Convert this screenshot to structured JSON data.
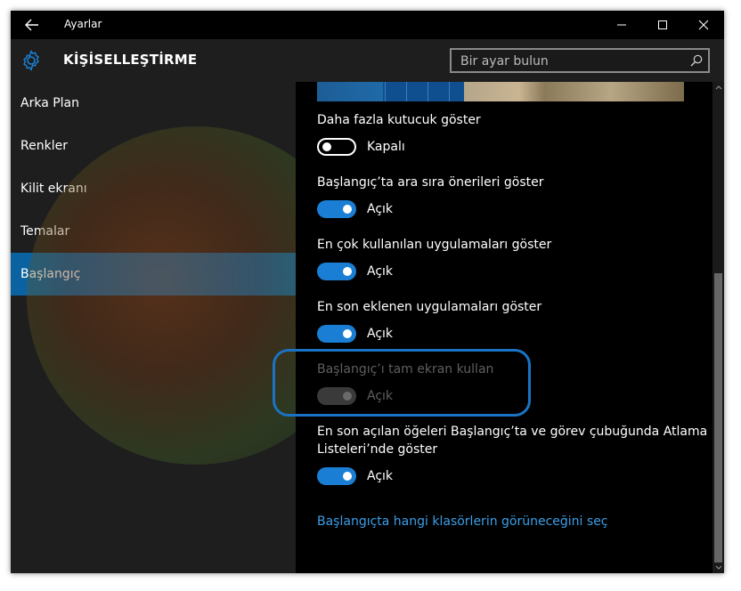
{
  "window": {
    "title": "Ayarlar",
    "icons": {
      "back": "back-arrow-icon",
      "minimize": "minimize-icon",
      "maximize": "maximize-icon",
      "close": "close-icon"
    }
  },
  "header": {
    "title": "KİŞİSELLEŞTİRME",
    "icon": "gear-icon",
    "search_placeholder": "Bir ayar bulun",
    "search_icon": "search-icon"
  },
  "sidebar": {
    "items": [
      {
        "label": "Arka Plan",
        "active": false
      },
      {
        "label": "Renkler",
        "active": false
      },
      {
        "label": "Kilit ekranı",
        "active": false
      },
      {
        "label": "Temalar",
        "active": false
      },
      {
        "label": "Başlangıç",
        "active": true
      }
    ]
  },
  "settings": [
    {
      "label": "Daha fazla kutucuk göster",
      "state": "Kapalı",
      "on": false,
      "enabled": true
    },
    {
      "label": "Başlangıç’ta ara sıra önerileri göster",
      "state": "Açık",
      "on": true,
      "enabled": true
    },
    {
      "label": "En çok kullanılan uygulamaları göster",
      "state": "Açık",
      "on": true,
      "enabled": true
    },
    {
      "label": "En son eklenen uygulamaları göster",
      "state": "Açık",
      "on": true,
      "enabled": true
    },
    {
      "label": "Başlangıç’ı tam ekran kullan",
      "state": "Açık",
      "on": true,
      "enabled": false
    },
    {
      "label_line1": "En son açılan öğeleri Başlangıç’ta ve görev çubuğunda Atlama",
      "label_line2": "Listeleri’nde göster",
      "state": "Açık",
      "on": true,
      "enabled": true
    }
  ],
  "link": "Başlangıçta hangi klasörlerin görüneceğini seç",
  "colors": {
    "accent": "#1a7fd4",
    "active_nav": "#0a63a0",
    "link": "#3b9ee8",
    "highlight": "#1a73c4"
  }
}
